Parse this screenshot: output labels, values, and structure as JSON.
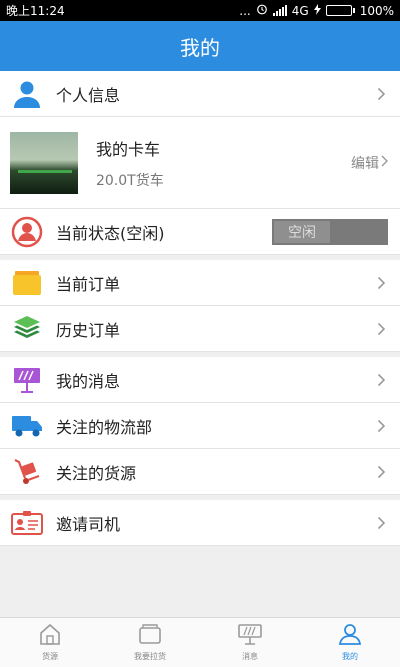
{
  "status_bar": {
    "time": "晚上11:24",
    "dots": "...",
    "network": "4G",
    "battery_percent": "100%",
    "battery_level": 1.0
  },
  "header": {
    "title": "我的"
  },
  "menu": {
    "profile": {
      "label": "个人信息",
      "icon": "person-icon"
    },
    "truck": {
      "title": "我的卡车",
      "subtitle": "20.0T货车",
      "edit_label": "编辑"
    },
    "status": {
      "label": "当前状态(空闲)",
      "toggle_text": "空闲",
      "icon": "driver-status-icon"
    },
    "current_orders": {
      "label": "当前订单",
      "icon": "folder-icon"
    },
    "history_orders": {
      "label": "历史订单",
      "icon": "layers-icon"
    },
    "messages": {
      "label": "我的消息",
      "icon": "billboard-icon"
    },
    "followed_logistics": {
      "label": "关注的物流部",
      "icon": "truck-icon"
    },
    "followed_cargo": {
      "label": "关注的货源",
      "icon": "hand-cart-icon"
    },
    "invite_driver": {
      "label": "邀请司机",
      "icon": "id-card-icon"
    }
  },
  "tabs": [
    {
      "label": "货源",
      "icon": "home-icon",
      "active": false
    },
    {
      "label": "我要拉货",
      "icon": "box-icon",
      "active": false
    },
    {
      "label": "消息",
      "icon": "billboard-icon",
      "active": false
    },
    {
      "label": "我的",
      "icon": "user-icon",
      "active": true
    }
  ],
  "colors": {
    "accent": "#2c8de0",
    "background": "#efefef",
    "battery": "#4cd137"
  }
}
